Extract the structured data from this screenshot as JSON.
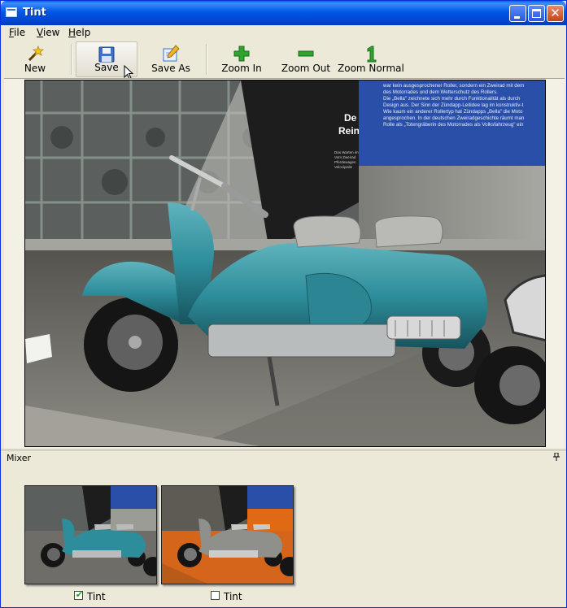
{
  "window": {
    "title": "Tint"
  },
  "menu": {
    "file": "File",
    "view": "View",
    "help": "Help"
  },
  "toolbar": {
    "new": "New",
    "save": "Save",
    "save_as": "Save As",
    "zoom_in": "Zoom In",
    "zoom_out": "Zoom Out",
    "zoom_normal": "Zoom Normal"
  },
  "photo": {
    "sign_heading_1": "De",
    "sign_heading_2": "Rein",
    "sign_caption_1": "Das Warten im",
    "sign_caption_2": "Vom Zweirad",
    "sign_caption_3": "Pferdewagen",
    "sign_caption_4": "Velocipede",
    "panel_lines": [
      "war kein ausgesprochener Roller, sondern ein Zweirad mit dem",
      "des Motorrades und dem Wetterschutz des Rollers.",
      "Die „Bella\" zeichnete sich mehr durch Funktionalität als durch",
      "Design aus. Der Sinn der Zündapp-Leitidee lag im konstruktiv-t",
      "Wie kaum ein anderer Rollertyp hat Zündapps „Bella\" die Moto",
      "angesprochen. In der deutschen Zweiradgeschichte räumt man",
      "Rolle als „Totengräberin des Motorrades als Volksfahrzeug\" ein"
    ]
  },
  "mixer": {
    "title": "Mixer",
    "pin_icon": "pin-icon",
    "items": [
      {
        "label": "Tint",
        "checked": true
      },
      {
        "label": "Tint",
        "checked": false
      }
    ]
  },
  "colors": {
    "accent_teal": "#2d8d9a",
    "tint_orange": "#e06a14",
    "panel_blue": "#2a4fa8",
    "window_bg": "#ece9d8"
  }
}
